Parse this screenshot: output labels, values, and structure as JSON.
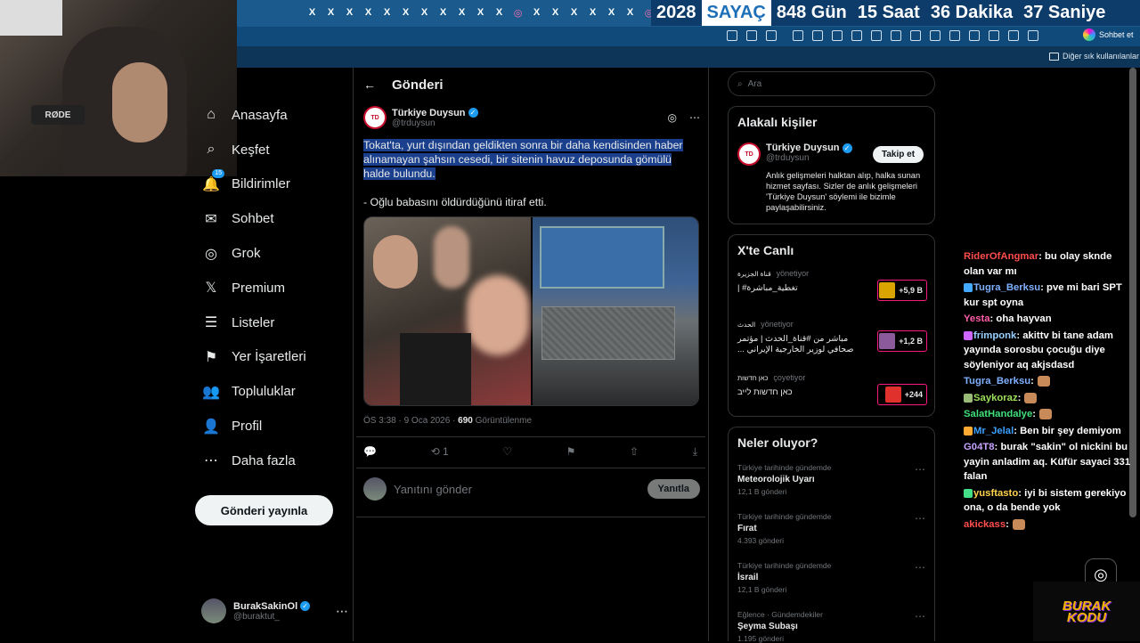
{
  "browser": {
    "tab_icons": [
      "X",
      "X",
      "X",
      "X",
      "X",
      "X",
      "X",
      "X",
      "X",
      "X",
      "X",
      "◎",
      "X",
      "X",
      "X",
      "X",
      "X",
      "X",
      "◎"
    ],
    "counter": {
      "year": "2028",
      "label": "SAYAÇ",
      "days": "848 Gün",
      "hours": "15 Saat",
      "minutes": "36 Dakika",
      "seconds": "37 Saniye"
    },
    "copilot_label": "Sohbet et",
    "bookmarks_label": "Diğer sık kullanılanlar"
  },
  "nav": {
    "items": [
      {
        "label": "Anasayfa",
        "icon": "⌂"
      },
      {
        "label": "Keşfet",
        "icon": "⌕"
      },
      {
        "label": "Bildirimler",
        "icon": "🔔",
        "badge": "15"
      },
      {
        "label": "Sohbet",
        "icon": "✉"
      },
      {
        "label": "Grok",
        "icon": "◎"
      },
      {
        "label": "Premium",
        "icon": "𝕏"
      },
      {
        "label": "Listeler",
        "icon": "☰"
      },
      {
        "label": "Yer İşaretleri",
        "icon": "⚑"
      },
      {
        "label": "Topluluklar",
        "icon": "👥"
      },
      {
        "label": "Profil",
        "icon": "👤"
      },
      {
        "label": "Daha fazla",
        "icon": "⋯"
      }
    ],
    "post_button": "Gönderi yayınla",
    "account": {
      "name": "BurakSakinOl",
      "handle": "@buraktut_"
    }
  },
  "post": {
    "header": "Gönderi",
    "author_name": "Türkiye Duysun",
    "author_handle": "@trduysun",
    "text_selected": "Tokat'ta, yurt dışından geldikten sonra bir daha kendisinden haber alınamayan şahsın cesedi, bir sitenin havuz deposunda gömülü halde bulundu.",
    "text_second": "- Oğlu babasını öldürdüğünü itiraf etti.",
    "time": "ÖS 3:38 · 9 Oca 2026 · ",
    "views": "690",
    "views_label": " Görüntülenme",
    "retweets": "1",
    "reply_placeholder": "Yanıtını gönder",
    "reply_button": "Yanıtla"
  },
  "sidebar": {
    "search_placeholder": "Ara",
    "related_title": "Alakalı kişiler",
    "related": {
      "name": "Türkiye Duysun",
      "handle": "@trduysun",
      "follow": "Takip et",
      "bio": "Anlık gelişmeleri halktan alıp, halka sunan hizmet sayfası. Sizler de anlık gelişmeleri 'Türkiye Duysun' söylemi ile bizimle paylaşabilirsiniz."
    },
    "live_title": "X'te Canlı",
    "live": [
      {
        "source": "قناة الجزيرة",
        "role": "yönetiyor",
        "title": "تغطية_مباشرة# |",
        "count": "+5,9 B",
        "color": "#d9a400"
      },
      {
        "source": "الحدث",
        "role": "yönetiyor",
        "title": "مباشر من #قناة_الحدث | مؤتمر صحافي لوزير الخارجية الإيراني ...",
        "count": "+1,2 B",
        "color": "#8a5a9a"
      },
      {
        "source": "כאן חדשות",
        "role": "çoyetiyor",
        "title": "כאן חדשות לייב",
        "count": "+244",
        "color": "#e0312c"
      }
    ],
    "trends_title": "Neler oluyor?",
    "trends": [
      {
        "cat": "Türkiye tarihinde gündemde",
        "name": "Meteorolojik Uyarı",
        "cnt": "12,1 B gönderi"
      },
      {
        "cat": "Türkiye tarihinde gündemde",
        "name": "Fırat",
        "cnt": "4.393 gönderi"
      },
      {
        "cat": "Türkiye tarihinde gündemde",
        "name": "İsrail",
        "cnt": "12,1 B gönderi"
      },
      {
        "cat": "Eğlence · Gündemdekiler",
        "name": "Şeyma Subaşı",
        "cnt": "1.195 gönderi"
      }
    ]
  },
  "chat": {
    "messages": [
      {
        "user": "RiderOfAngmar",
        "color": "#ff4d4d",
        "text": " bu olay sknde olan var mı"
      },
      {
        "user": "Tugra_Berksu",
        "color": "#7fb0ff",
        "text": " pve mi bari SPT kur spt oyna"
      },
      {
        "user": "Yesta",
        "color": "#ff5ea8",
        "text": " oha hayvan"
      },
      {
        "user": "frimponk",
        "color": "#9ad0ff",
        "text": " akittv bi tane adam yayında sorosbu çocuğu diye söyleniyor aq akjsdasd"
      },
      {
        "user": "Tugra_Berksu",
        "color": "#7fb0ff",
        "text": ""
      },
      {
        "user": "Saykoraz",
        "color": "#9be05a",
        "text": ""
      },
      {
        "user": "SalatHandalye",
        "color": "#3fe07a",
        "text": ""
      },
      {
        "user": "Mr_Jelal",
        "color": "#3ba0ff",
        "text": " Ben bir şey demiyom"
      },
      {
        "user": "G04T8",
        "color": "#c7a2ff",
        "text": " burak \"sakin\" ol nickini bu yayin anladim aq. Küfür sayaci 331 falan"
      },
      {
        "user": "yusftasto",
        "color": "#ffd24d",
        "text": " iyi bi sistem gerekiyo ona, o da bende yok"
      },
      {
        "user": "akickass",
        "color": "#ff4d4d",
        "text": ""
      }
    ],
    "logo_line1": "BURAK",
    "logo_line2": "KODU"
  }
}
